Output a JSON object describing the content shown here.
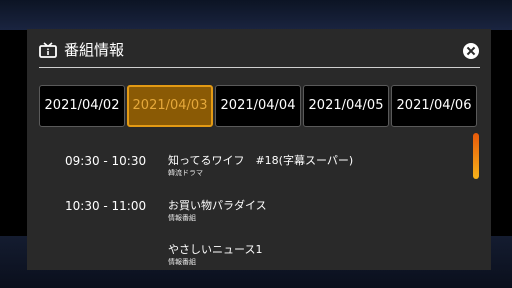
{
  "header": {
    "title": "番組情報",
    "icon": "tv-info-icon",
    "close_icon": "close-icon"
  },
  "date_tabs": [
    {
      "label": "2021/04/02",
      "selected": false
    },
    {
      "label": "2021/04/03",
      "selected": true
    },
    {
      "label": "2021/04/04",
      "selected": false
    },
    {
      "label": "2021/04/05",
      "selected": false
    },
    {
      "label": "2021/04/06",
      "selected": false
    }
  ],
  "programs": [
    {
      "time": "09:30 - 10:30",
      "title": "知ってるワイフ　#18(字幕スーパー)",
      "genre": "韓流ドラマ"
    },
    {
      "time": "10:30 - 11:00",
      "title": "お買い物パラダイス",
      "genre": "情報番組"
    },
    {
      "time": "",
      "title": "やさしいニュース1",
      "genre": "情報番組"
    }
  ],
  "colors": {
    "panel_bg": "#292929",
    "tab_bg": "#000000",
    "selected_tab_bg": "#8a5a05",
    "selected_tab_border": "#e39a14",
    "selected_tab_text": "#e5a83a",
    "scrollbar_top": "#e85a0a",
    "scrollbar_bottom": "#f6b21a"
  }
}
